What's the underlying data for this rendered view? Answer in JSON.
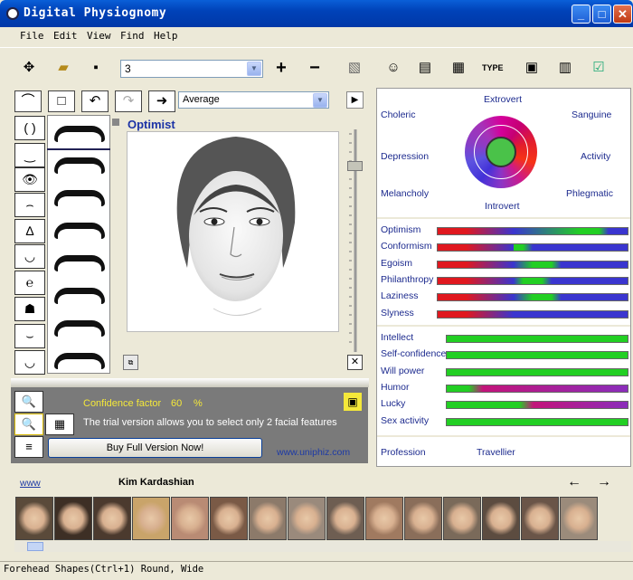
{
  "window": {
    "title": "Digital Physiognomy",
    "minimize": "_",
    "maximize": "□",
    "close": "✕"
  },
  "menu": [
    "File",
    "Edit",
    "View",
    "Find",
    "Help"
  ],
  "toolbar": {
    "profile_value": "3",
    "plus_label": "+",
    "minus_label": "−",
    "icons": [
      "move-icon",
      "open-folder-icon",
      "save-icon",
      "add-icon",
      "remove-icon",
      "image-icon",
      "face-icon",
      "document-icon",
      "report-icon",
      "type-icon",
      "print-icon",
      "export-icon",
      "checkmark-icon"
    ]
  },
  "editor": {
    "average_value": "Average",
    "face_label": "Optimist",
    "play": "▶",
    "reset": "✕"
  },
  "trial": {
    "confidence_label": "Confidence factor",
    "confidence_value": "60",
    "confidence_unit": "%",
    "message": "The trial version allows you to select only 2 facial features",
    "buy_button": "Buy Full Version Now!",
    "site": "www.uniphiz.com"
  },
  "temperament": {
    "extrovert": "Extrovert",
    "choleric": "Choleric",
    "sanguine": "Sanguine",
    "depression": "Depression",
    "activity": "Activity",
    "melancholy": "Melancholy",
    "phlegmatic": "Phlegmatic",
    "introvert": "Introvert"
  },
  "traits_group1": [
    {
      "label": "Optimism",
      "green": 0.85
    },
    {
      "label": "Conformism",
      "green": 0.45
    },
    {
      "label": "Egoism",
      "green": 0.6
    },
    {
      "label": "Philanthropy",
      "green": 0.55
    },
    {
      "label": "Laziness",
      "green": 0.6
    },
    {
      "label": "Slyness",
      "green": 0.3
    }
  ],
  "traits_group2": [
    {
      "label": "Intellect",
      "green": 1.0
    },
    {
      "label": "Self-confidence",
      "green": 1.0
    },
    {
      "label": "Will power",
      "green": 1.0
    },
    {
      "label": "Humor",
      "green": 0.12
    },
    {
      "label": "Lucky",
      "green": 0.4
    },
    {
      "label": "Sex activity",
      "green": 1.0
    }
  ],
  "profession": {
    "label": "Profession",
    "value": "Travellier"
  },
  "celebrities": {
    "link": "www",
    "name": "Kim Kardashian",
    "prev": "←",
    "next": "→",
    "count": 15
  },
  "status": "Forehead Shapes(Ctrl+1) Round, Wide",
  "colors": {
    "accent": "#0a5fd8",
    "label_blue": "#1c2a8e",
    "confidence_yellow": "#f4e83a"
  }
}
